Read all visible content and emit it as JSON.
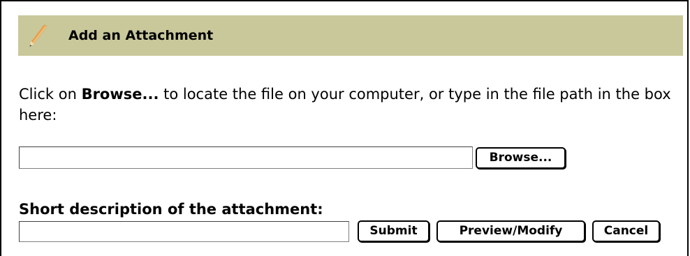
{
  "header": {
    "icon": "pencil-icon",
    "title": "Add an Attachment",
    "background_color": "#c8c89a"
  },
  "instructions": {
    "prefix": "Click on ",
    "emphasis": "Browse...",
    "suffix": " to locate the file on your computer, or type in the file path in the box here:"
  },
  "file_input": {
    "value": "",
    "browse_label": "Browse..."
  },
  "description": {
    "label": "Short description of the attachment:",
    "value": ""
  },
  "actions": {
    "submit_label": "Submit",
    "preview_label": "Preview/Modify",
    "cancel_label": "Cancel"
  }
}
